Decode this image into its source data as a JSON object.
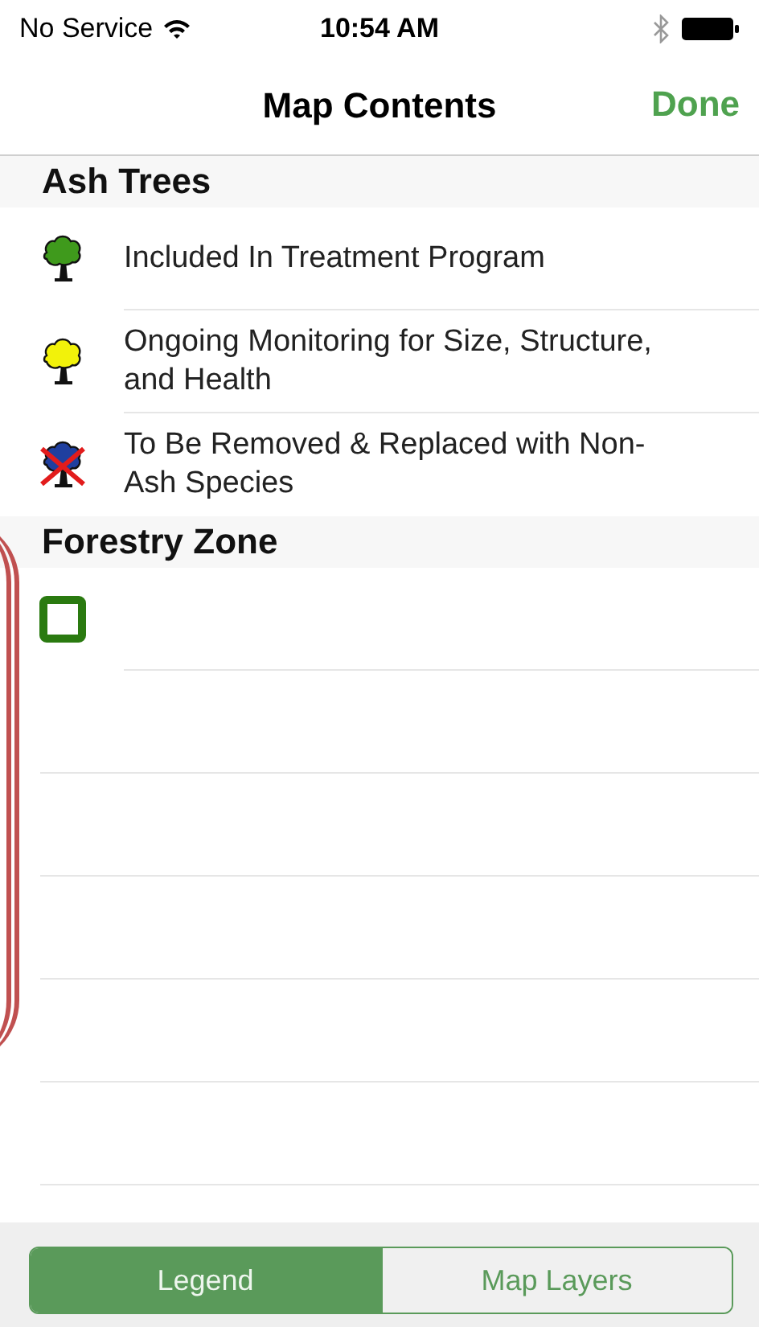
{
  "status_bar": {
    "carrier": "No Service",
    "time": "10:54 AM"
  },
  "nav_bar": {
    "title": "Map Contents",
    "done": "Done"
  },
  "sections": [
    {
      "title": "Ash Trees",
      "items": [
        {
          "kind": "tree",
          "color": "#3f9a1c",
          "label": "Included In Treatment Program"
        },
        {
          "kind": "tree",
          "color": "#f2f20a",
          "label": "Ongoing Monitoring for Size, Structure, and Health"
        },
        {
          "kind": "crossed-tree",
          "color": "#1f3f9f",
          "label": "To Be Removed & Replaced with Non-Ash Species"
        }
      ]
    },
    {
      "title": "Forestry Zone",
      "items": [
        {
          "kind": "square",
          "color": "#2a7a10"
        }
      ]
    }
  ],
  "tabs": [
    {
      "label": "Legend",
      "selected": true
    },
    {
      "label": "Map Layers",
      "selected": false
    }
  ]
}
